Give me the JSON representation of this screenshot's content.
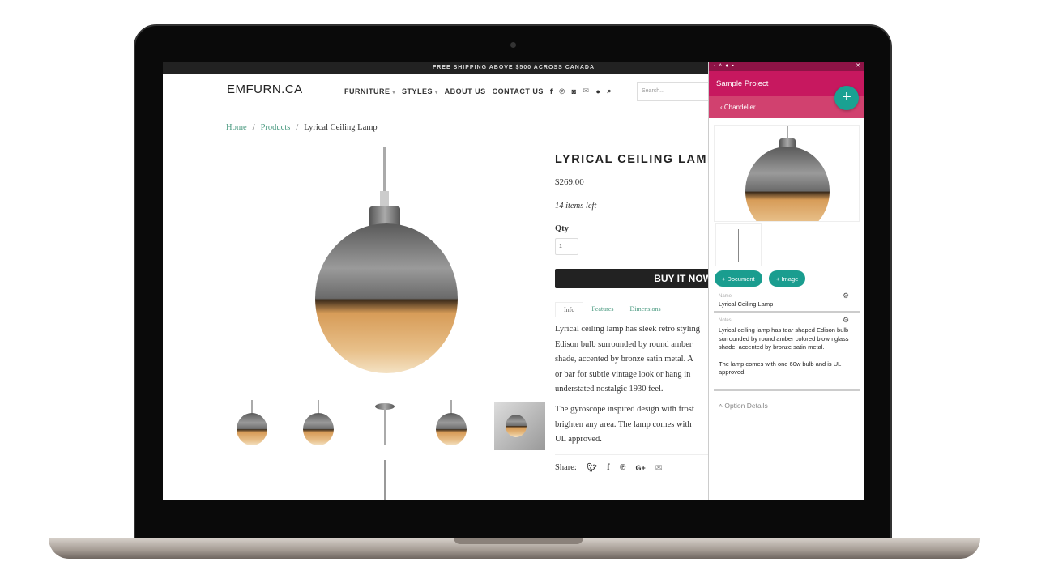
{
  "store": {
    "announcement": "FREE SHIPPING ABOVE $500 ACROSS CANADA",
    "logo": "EMFURN.CA",
    "nav": [
      "FURNITURE",
      "STYLES",
      "ABOUT US",
      "CONTACT US"
    ],
    "nav_dropdown_caret": "▾",
    "social_icons": [
      "facebook-icon",
      "pinterest-icon",
      "instagram-icon",
      "mail-icon",
      "user-icon",
      "search-icon"
    ],
    "search_placeholder": "Search...",
    "breadcrumb": [
      "Home",
      "Products",
      "Lyrical Ceiling Lamp"
    ],
    "product": {
      "title": "LYRICAL CEILING LAMP",
      "price": "$269.00",
      "stock": "14 items left",
      "qty_label": "Qty",
      "qty_value": "1",
      "buy_label": "BUY IT NOW",
      "tabs": [
        "Info",
        "Features",
        "Dimensions"
      ],
      "desc_lines": [
        "Lyrical ceiling lamp has sleek retro styling",
        "Edison bulb surrounded by round amber",
        "shade, accented by bronze satin metal. A",
        "or bar for subtle vintage look or hang in",
        "understated nostalgic 1930 feel."
      ],
      "desc2_lines": [
        "The gyroscope inspired design with frost",
        "brighten any area. The lamp comes with",
        "UL approved."
      ],
      "share_label": "Share:"
    }
  },
  "panel": {
    "toolbar_icons": [
      "back-icon",
      "collapse-icon",
      "eye-icon",
      "save-icon",
      "close-icon"
    ],
    "project": "Sample Project",
    "back_label": "Chandelier",
    "add_document": "+ Document",
    "add_image": "+ Image",
    "name_label": "Name",
    "name_value": "Lyrical Ceiling Lamp",
    "notes_label": "Notes",
    "notes_p1": "Lyrical ceiling lamp has tear shaped Edison bulb surrounded by round amber colored blown glass shade, accented by bronze satin metal.",
    "notes_p2": "The lamp comes with one 60w bulb and is UL approved.",
    "option_details": "Option Details",
    "accent": "#c7185f",
    "fab_color": "#1aa192"
  }
}
